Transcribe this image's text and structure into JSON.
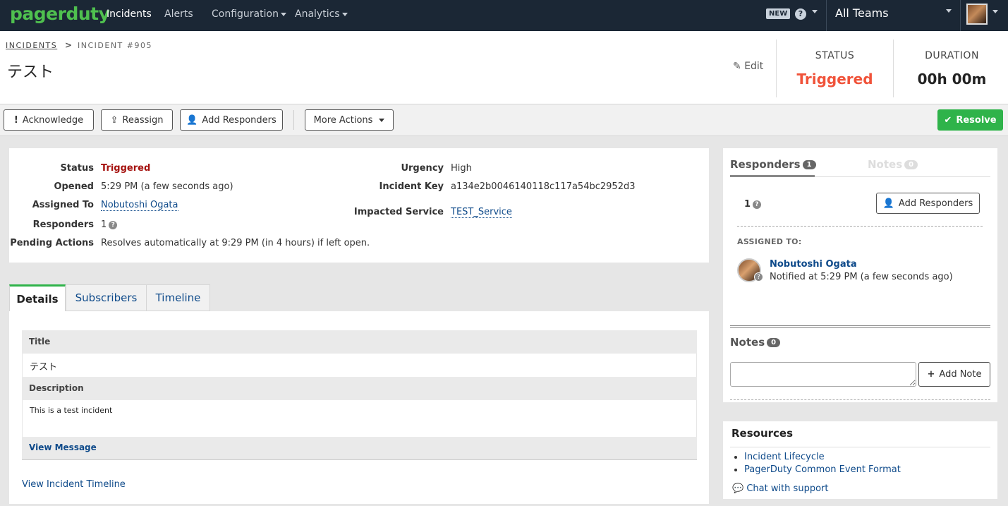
{
  "nav": {
    "logo": "pagerduty",
    "items": [
      "Incidents",
      "Alerts",
      "Configuration",
      "Analytics"
    ],
    "new_badge": "NEW",
    "help": "?",
    "team": "All Teams"
  },
  "header": {
    "breadcrumb_root": "INCIDENTS",
    "breadcrumb_current": "INCIDENT #905",
    "title": "テスト",
    "edit": "Edit",
    "status_label": "STATUS",
    "status_value": "Triggered",
    "duration_label": "DURATION",
    "duration_value": "00h 00m",
    "status_color": "#f0533a"
  },
  "toolbar": {
    "acknowledge": "Acknowledge",
    "reassign": "Reassign",
    "add_responders": "Add Responders",
    "more_actions": "More Actions",
    "resolve": "Resolve",
    "resolve_color": "#2fb34a"
  },
  "summary": {
    "status_key": "Status",
    "status_val": "Triggered",
    "opened_key": "Opened",
    "opened_val": "5:29 PM (a few seconds ago)",
    "assigned_key": "Assigned To",
    "assigned_val": "Nobutoshi Ogata",
    "responders_key": "Responders",
    "responders_val": "1",
    "pending_key": "Pending Actions",
    "pending_val": "Resolves automatically at 9:29 PM (in 4 hours) if left open.",
    "urgency_key": "Urgency",
    "urgency_val": "High",
    "key_key": "Incident Key",
    "key_val": "a134e2b0046140118c117a54bc2952d3",
    "service_key": "Impacted Service",
    "service_val": "TEST_Service"
  },
  "tabs": [
    "Details",
    "Subscribers",
    "Timeline"
  ],
  "details": {
    "title_head": "Title",
    "title_val": "テスト",
    "desc_head": "Description",
    "desc_val": "This is a test incident",
    "view_message": "View Message",
    "view_timeline": "View Incident Timeline"
  },
  "responders_panel": {
    "tab_responders": "Responders",
    "responders_count": "1",
    "tab_notes": "Notes",
    "notes_count": "0",
    "count": "1",
    "add_responders": "Add Responders",
    "assigned_to": "ASSIGNED TO:",
    "name": "Nobutoshi Ogata",
    "notified": "Notified at 5:29 PM (a few seconds ago)",
    "notes_title": "Notes",
    "notes_badge": "0",
    "add_note": "Add Note"
  },
  "resources": {
    "title": "Resources",
    "links": [
      "Incident Lifecycle",
      "PagerDuty Common Event Format"
    ],
    "chat": "Chat with support"
  }
}
